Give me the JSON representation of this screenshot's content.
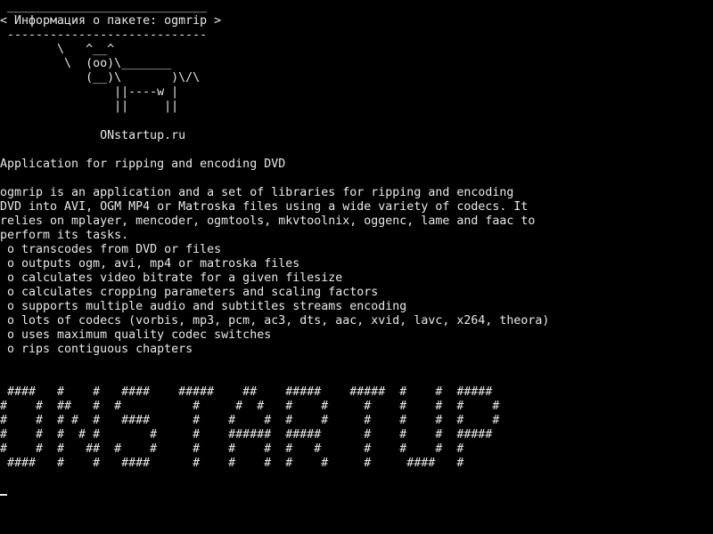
{
  "terminal": {
    "cowsay_lines": [
      " ____________________________",
      "< Информация о пакете: ogmrip >",
      " ----------------------------",
      "        \\   ^__^",
      "         \\  (oo)\\_______",
      "            (__)\\       )\\/\\",
      "                ||----w |",
      "                ||     ||"
    ],
    "site": "              ONstartup.ru",
    "summary": "Application for ripping and encoding DVD",
    "description_lines": [
      "ogmrip is an application and a set of libraries for ripping and encoding",
      "DVD into AVI, OGM MP4 or Matroska files using a wide variety of codecs. It",
      "relies on mplayer, mencoder, ogmtools, mkvtoolnix, oggenc, lame and faac to",
      "perform its tasks."
    ],
    "features": [
      " o transcodes from DVD or files",
      " o outputs ogm, avi, mp4 or matroska files",
      " o calculates video bitrate for a given filesize",
      " o calculates cropping parameters and scaling factors",
      " o supports multiple audio and subtitles streams encoding",
      " o lots of codecs (vorbis, mp3, pcm, ac3, dts, aac, xvid, lavc, x264, theora)",
      " o uses maximum quality codec switches",
      " o rips contiguous chapters"
    ],
    "banner_lines": [
      " ####   #    #   ####    #####    ##    #####    #####  #    #  #####",
      "#    #  ##   #  #          #     #  #   #    #     #    #    #  #    #",
      "#    #  # #  #   ####      #    #    #  #    #     #    #    #  #    #",
      "#    #  #  # #       #     #    ######  #####      #    #    #  #####",
      "#    #  #   ##  #    #     #    #    #  #   #      #    #    #  #",
      " ####   #    #   ####      #    #    #  #    #     #     ####   #"
    ]
  }
}
